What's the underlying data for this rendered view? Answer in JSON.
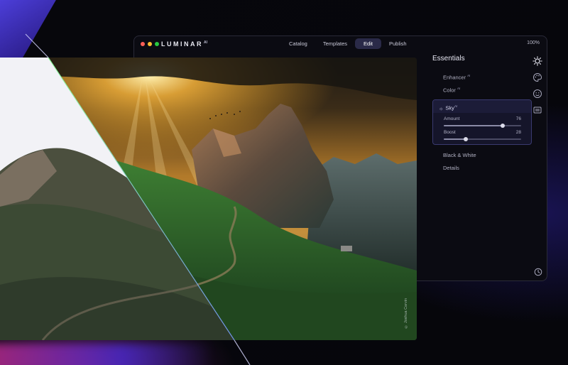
{
  "app": {
    "brand": "LUMINAR",
    "brand_sup": "AI",
    "zoom": "100%"
  },
  "nav": {
    "items": [
      "Catalog",
      "Templates",
      "Edit",
      "Publish"
    ],
    "active": "Edit"
  },
  "panel": {
    "title": "Essentials",
    "enhancer": {
      "label": "Enhancer",
      "sup": "AI"
    },
    "color": {
      "label": "Color",
      "sup": "AI"
    },
    "sky": {
      "label": "Sky",
      "sup": "AI",
      "amount": {
        "label": "Amount",
        "value": "76",
        "fraction": 0.76
      },
      "boost": {
        "label": "Boost",
        "value": "28",
        "fraction": 0.28
      }
    },
    "black_white": "Black & White",
    "details": "Details"
  },
  "rail_icons": [
    "sun-icon",
    "palette-icon",
    "face-icon",
    "portrait-icon",
    "history-icon"
  ],
  "photo": {
    "credit": "© Joshua Cervin",
    "colors": {
      "sky": "#f5a623",
      "sky_top": "#2b2116",
      "grass": "#2f6e2a",
      "rock": "#6d5a4a",
      "white": "#f3f3f6"
    }
  }
}
